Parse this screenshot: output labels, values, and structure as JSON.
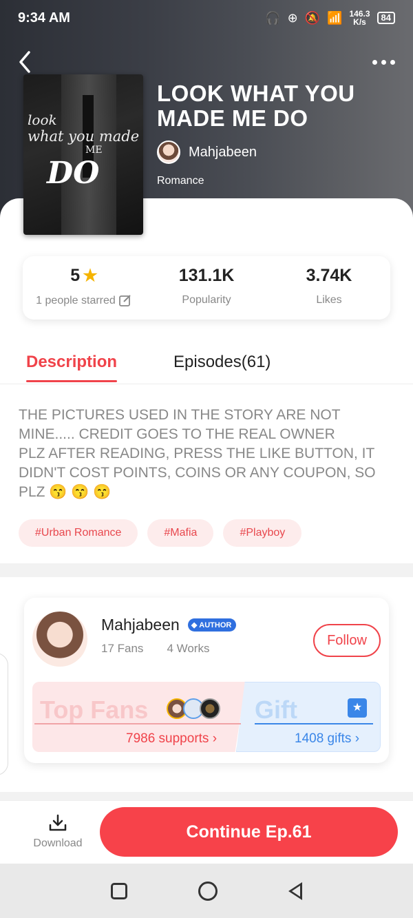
{
  "status_bar": {
    "time": "9:34 AM",
    "net_speed_value": "146.3",
    "net_speed_unit": "K/s",
    "battery": "84"
  },
  "book": {
    "title": "LOOK WHAT YOU MADE ME DO",
    "author": "Mahjabeen",
    "genre": "Romance",
    "cover_text": {
      "line1": "look",
      "line2": "what you made",
      "line3": "ME",
      "line4": "DO"
    }
  },
  "stats": {
    "rating_value": "5",
    "rating_label": "1 people starred",
    "popularity_value": "131.1K",
    "popularity_label": "Popularity",
    "likes_value": "3.74K",
    "likes_label": "Likes"
  },
  "tabs": {
    "description": "Description",
    "episodes": "Episodes(61)"
  },
  "description": "THE PICTURES USED IN THE STORY ARE NOT MINE..... CREDIT GOES TO THE REAL OWNER\nPLZ AFTER READING, PRESS THE LIKE BUTTON, IT DIDN'T COST POINTS, COINS OR ANY COUPON, SO PLZ 😙 😙 😙",
  "tags": [
    "#Urban Romance",
    "#Mafia",
    "#Playboy"
  ],
  "author_card": {
    "name": "Mahjabeen",
    "badge": "AUTHOR",
    "fans": "17 Fans",
    "works": "4 Works",
    "follow_label": "Follow",
    "top_fans_title": "Top Fans",
    "supports": "7986 supports",
    "gift_title": "Gift",
    "gifts": "1408 gifts"
  },
  "bottom_bar": {
    "download_label": "Download",
    "continue_label": "Continue Ep.61"
  },
  "colors": {
    "accent": "#f0434a",
    "gift_blue": "#3a86e8",
    "star": "#f5b400"
  }
}
